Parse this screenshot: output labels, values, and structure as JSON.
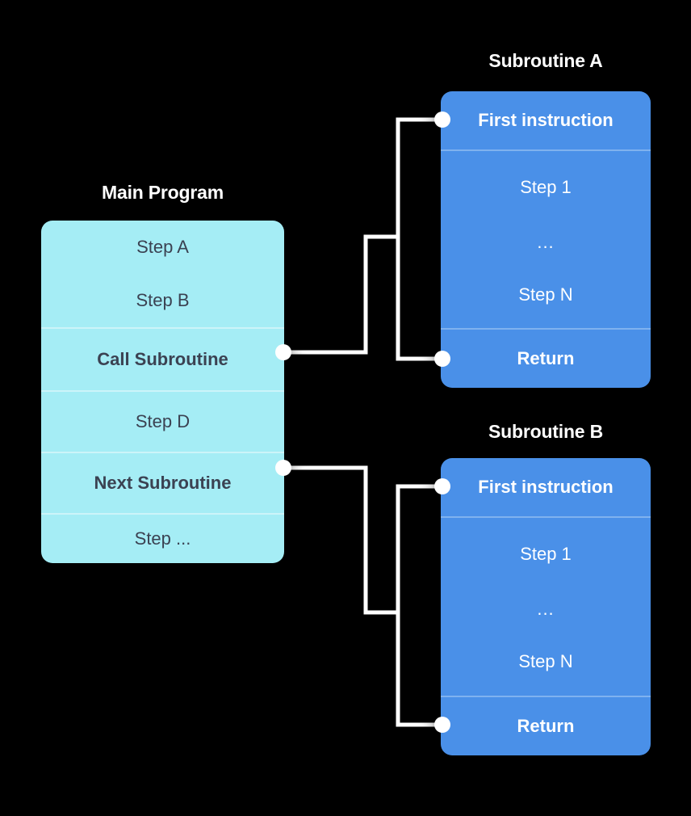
{
  "diagram": {
    "background_color": "#000000",
    "main_color": "#a5edf5",
    "sub_color": "#4a90e8",
    "line_color": "#ffffff",
    "main_text_color": "#3b4252",
    "sub_text_color": "#ffffff"
  },
  "main_program": {
    "title": "Main Program",
    "rows": [
      {
        "label": "Step A",
        "emphasis": false
      },
      {
        "label": "Step B",
        "emphasis": false
      },
      {
        "label": "Call Subroutine",
        "emphasis": true
      },
      {
        "label": "Step D",
        "emphasis": false
      },
      {
        "label": "Next Subroutine",
        "emphasis": true
      },
      {
        "label": "Step ...",
        "emphasis": false
      }
    ]
  },
  "subroutine_a": {
    "title": "Subroutine A",
    "rows": [
      {
        "label": "First instruction",
        "emphasis": true
      },
      {
        "label": "Step 1",
        "emphasis": false
      },
      {
        "label": "...",
        "emphasis": false
      },
      {
        "label": "Step N",
        "emphasis": false
      },
      {
        "label": "Return",
        "emphasis": true
      }
    ]
  },
  "subroutine_b": {
    "title": "Subroutine B",
    "rows": [
      {
        "label": "First instruction",
        "emphasis": true
      },
      {
        "label": "Step 1",
        "emphasis": false
      },
      {
        "label": "...",
        "emphasis": false
      },
      {
        "label": "Step N",
        "emphasis": false
      },
      {
        "label": "Return",
        "emphasis": true
      }
    ]
  },
  "connectors": [
    {
      "name": "call-subroutine-a",
      "from": "Call Subroutine",
      "to": "First instruction (Subroutine A)"
    },
    {
      "name": "return-subroutine-a",
      "from": "Return (Subroutine A)",
      "to": "Step D"
    },
    {
      "name": "call-subroutine-b",
      "from": "Next Subroutine",
      "to": "First instruction (Subroutine B)"
    },
    {
      "name": "return-subroutine-b",
      "from": "Return (Subroutine B)",
      "to": "Step ..."
    }
  ]
}
